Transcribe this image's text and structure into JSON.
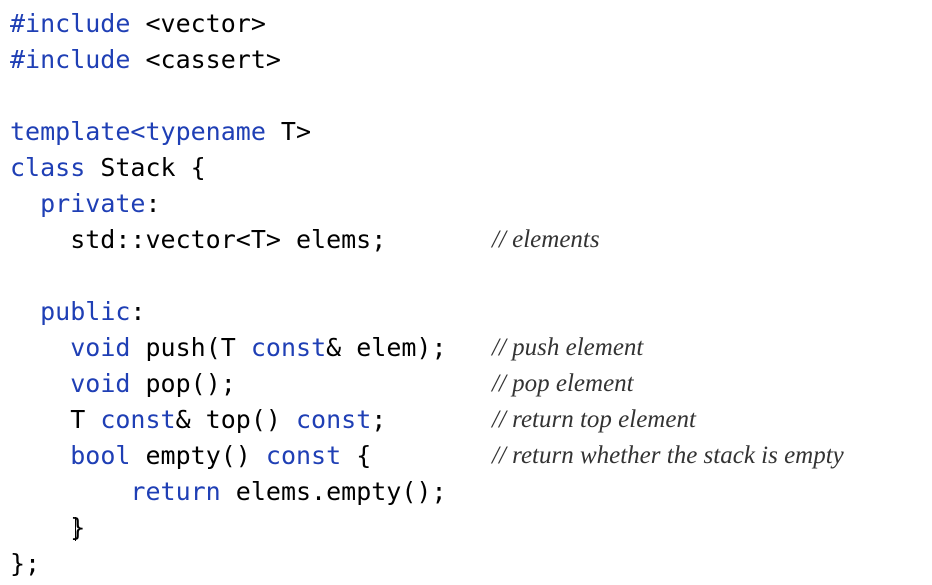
{
  "code": {
    "lines": [
      {
        "parts": [
          {
            "t": "#include",
            "kw": true
          },
          {
            "t": " <vector>",
            "kw": false
          }
        ]
      },
      {
        "parts": [
          {
            "t": "#include",
            "kw": true
          },
          {
            "t": " <cassert>",
            "kw": false
          }
        ]
      },
      {
        "parts": []
      },
      {
        "parts": [
          {
            "t": "template<typename",
            "kw": true
          },
          {
            "t": " T>",
            "kw": false
          }
        ]
      },
      {
        "parts": [
          {
            "t": "class",
            "kw": true
          },
          {
            "t": " Stack {",
            "kw": false
          }
        ]
      },
      {
        "parts": [
          {
            "t": "  ",
            "kw": false
          },
          {
            "t": "private",
            "kw": true
          },
          {
            "t": ":",
            "kw": false
          }
        ]
      },
      {
        "parts": [
          {
            "t": "    std::vector<T> elems;",
            "kw": false
          }
        ],
        "comment": "// elements"
      },
      {
        "parts": []
      },
      {
        "parts": [
          {
            "t": "  ",
            "kw": false
          },
          {
            "t": "public",
            "kw": true
          },
          {
            "t": ":",
            "kw": false
          }
        ]
      },
      {
        "parts": [
          {
            "t": "    ",
            "kw": false
          },
          {
            "t": "void",
            "kw": true
          },
          {
            "t": " push(T ",
            "kw": false
          },
          {
            "t": "const",
            "kw": true
          },
          {
            "t": "& elem);",
            "kw": false
          }
        ],
        "comment": "// push element"
      },
      {
        "parts": [
          {
            "t": "    ",
            "kw": false
          },
          {
            "t": "void",
            "kw": true
          },
          {
            "t": " pop();",
            "kw": false
          }
        ],
        "comment": "// pop element"
      },
      {
        "parts": [
          {
            "t": "    T ",
            "kw": false
          },
          {
            "t": "const",
            "kw": true
          },
          {
            "t": "& top() ",
            "kw": false
          },
          {
            "t": "const",
            "kw": true
          },
          {
            "t": ";",
            "kw": false
          }
        ],
        "comment": "// return top element"
      },
      {
        "parts": [
          {
            "t": "    ",
            "kw": false
          },
          {
            "t": "bool",
            "kw": true
          },
          {
            "t": " empty() ",
            "kw": false
          },
          {
            "t": "const",
            "kw": true
          },
          {
            "t": " {",
            "kw": false
          }
        ],
        "comment": "// return whether the stack is empty"
      },
      {
        "parts": [
          {
            "t": "        ",
            "kw": false
          },
          {
            "t": "return",
            "kw": true
          },
          {
            "t": " elems.empty();",
            "kw": false
          }
        ]
      },
      {
        "parts": [
          {
            "t": "    }",
            "kw": false
          }
        ],
        "cursor": true
      },
      {
        "parts": [
          {
            "t": "};",
            "kw": false
          }
        ]
      }
    ]
  },
  "colors": {
    "keyword": "#1f3fb5",
    "text": "#000000",
    "comment": "#333333"
  }
}
